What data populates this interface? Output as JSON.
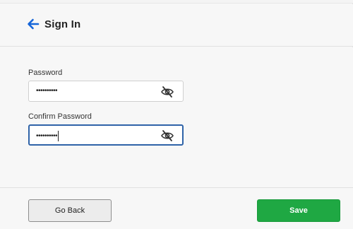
{
  "header": {
    "title": "Sign In",
    "back_icon": "arrow-left-icon",
    "accent_color": "#1565d8"
  },
  "form": {
    "password": {
      "label": "Password",
      "value": "••••••••••",
      "visibility_icon": "eye-off-icon"
    },
    "confirm_password": {
      "label": "Confirm Password",
      "value": "••••••••••",
      "visibility_icon": "eye-off-icon",
      "focused": true
    }
  },
  "footer": {
    "back_label": "Go Back",
    "save_label": "Save",
    "save_color": "#1fa843"
  }
}
